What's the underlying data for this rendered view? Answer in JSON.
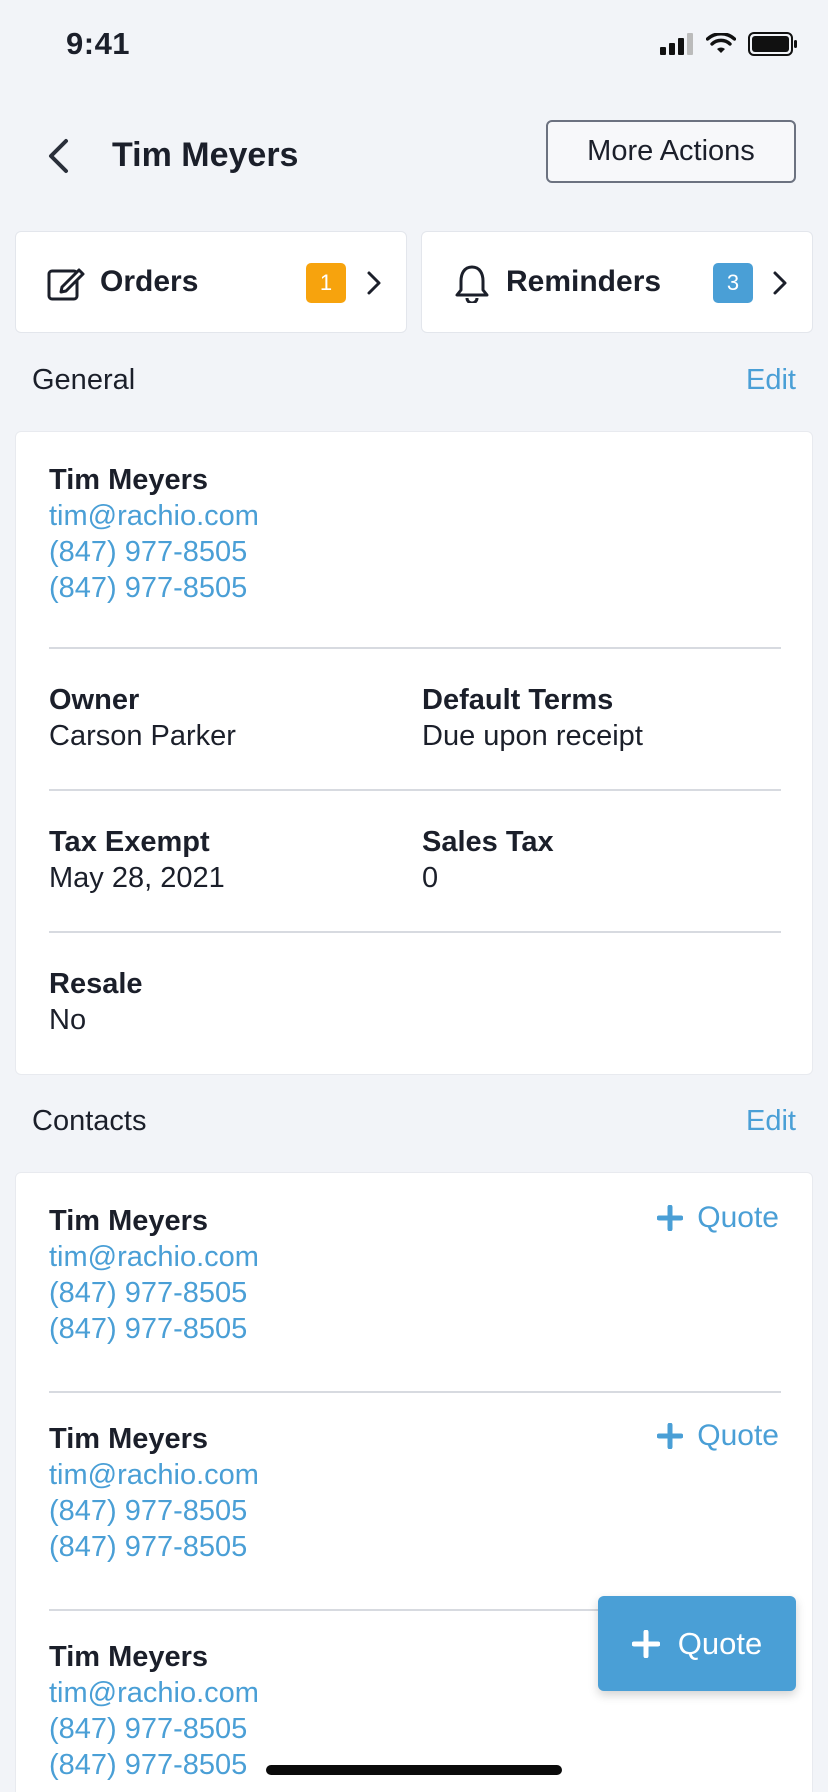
{
  "status_bar": {
    "time": "9:41"
  },
  "nav": {
    "title": "Tim Meyers",
    "more_actions_label": "More Actions"
  },
  "tiles": {
    "orders": {
      "label": "Orders",
      "count": "1"
    },
    "reminders": {
      "label": "Reminders",
      "count": "3"
    }
  },
  "general": {
    "title": "General",
    "edit_label": "Edit",
    "name": "Tim Meyers",
    "email": "tim@rachio.com",
    "phone_1": "(847) 977-8505",
    "phone_2": "(847) 977-8505",
    "fields": [
      {
        "label": "Owner",
        "value": "Carson Parker"
      },
      {
        "label": "Default Terms",
        "value": "Due upon receipt"
      },
      {
        "label": "Tax Exempt",
        "value": "May 28, 2021"
      },
      {
        "label": "Sales Tax",
        "value": "0"
      },
      {
        "label": "Resale",
        "value": "No"
      }
    ]
  },
  "contacts": {
    "title": "Contacts",
    "edit_label": "Edit",
    "quote_label": "Quote",
    "items": [
      {
        "name": "Tim Meyers",
        "email": "tim@rachio.com",
        "phone_1": "(847) 977-8505",
        "phone_2": "(847) 977-8505"
      },
      {
        "name": "Tim Meyers",
        "email": "tim@rachio.com",
        "phone_1": "(847) 977-8505",
        "phone_2": "(847) 977-8505"
      },
      {
        "name": "Tim Meyers",
        "email": "tim@rachio.com",
        "phone_1": "(847) 977-8505",
        "phone_2": "(847) 977-8505"
      }
    ]
  },
  "fab": {
    "label": "Quote"
  },
  "colors": {
    "accent": "#4a9fd6",
    "orders_badge": "#f7a30d",
    "background": "#f2f4f8"
  },
  "icons": [
    "signal-icon",
    "wifi-icon",
    "battery-icon",
    "back-chevron-icon",
    "edit-order-icon",
    "bell-icon",
    "chevron-right-icon",
    "plus-icon"
  ]
}
